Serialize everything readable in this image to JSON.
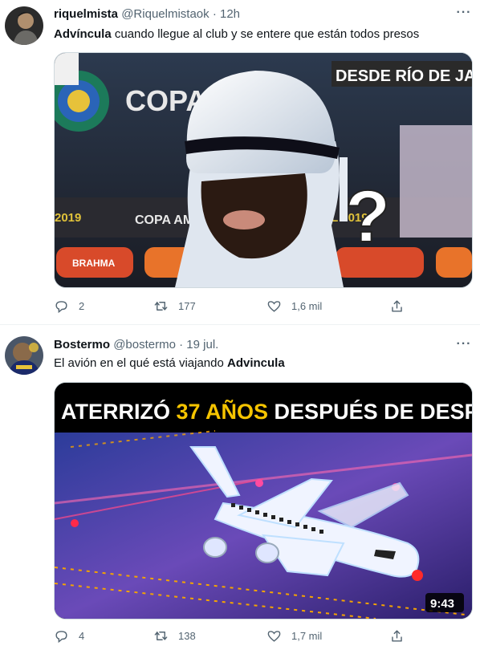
{
  "tweets": [
    {
      "display_name": "riquelmista",
      "handle": "@Riquelmistaok",
      "separator": "·",
      "time": "12h",
      "text_bold": "Advíncula",
      "text_rest": " cuando llegue al club y se entere que están todos presos",
      "media_text": {
        "banner": "DESDE RÍO DE JA",
        "copa": "COPA",
        "year_left": "2019",
        "copa_am": "COPA AM",
        "year_right": "SIL 2019",
        "brahma": "BRAHMA",
        "question": "?"
      },
      "replies": "2",
      "retweets": "177",
      "likes": "1,6 mil"
    },
    {
      "display_name": "Bostermo",
      "handle": "@bostermo",
      "separator": "·",
      "time": "19 jul.",
      "text_rest": "El avión en el qué está viajando ",
      "text_bold": "Advincula",
      "media_text": {
        "headline_a": "ATERRIZÓ ",
        "headline_b": "37 AÑOS",
        "headline_c": " DESPUÉS DE DESPEGAR",
        "duration": "9:43"
      },
      "replies": "4",
      "retweets": "138",
      "likes": "1,7 mil"
    }
  ],
  "icons": [
    "reply-icon",
    "retweet-icon",
    "like-icon",
    "share-icon",
    "more-icon"
  ],
  "colors": {
    "secondary": "#536471",
    "text": "#0f1419",
    "divider": "#eff3f4",
    "headline_yellow": "#f5c400"
  }
}
